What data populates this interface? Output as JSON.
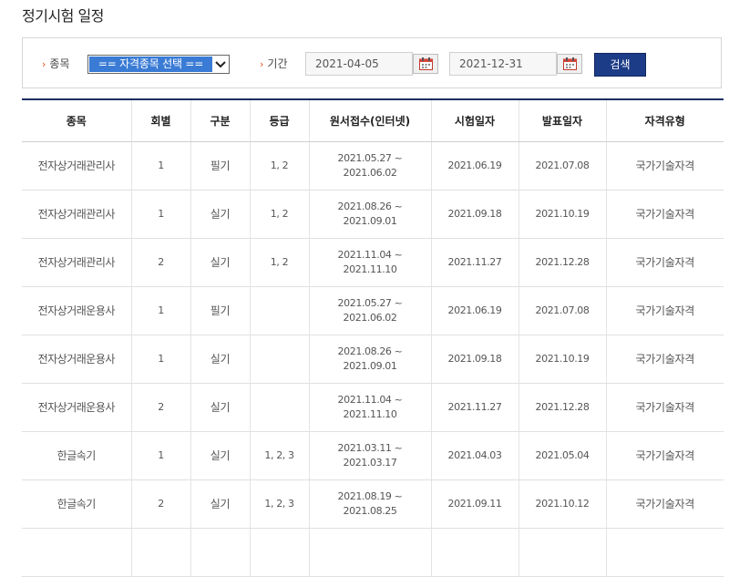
{
  "page": {
    "title": "정기시험 일정"
  },
  "search": {
    "type_label": "종목",
    "type_selected": "== 자격종목 선택 ==",
    "period_label": "기간",
    "start_date": "2021-04-05",
    "end_date": "2021-12-31",
    "button_label": "검색"
  },
  "table": {
    "headers": [
      "종목",
      "회별",
      "구분",
      "등급",
      "원서접수(인터넷)",
      "시험일자",
      "발표일자",
      "자격유형"
    ],
    "rows": [
      [
        "전자상거래관리사",
        "1",
        "필기",
        "1, 2",
        "2021.05.27 ~",
        "2021.06.02",
        "2021.06.19",
        "2021.07.08",
        "국가기술자격"
      ],
      [
        "전자상거래관리사",
        "1",
        "실기",
        "1, 2",
        "2021.08.26 ~",
        "2021.09.01",
        "2021.09.18",
        "2021.10.19",
        "국가기술자격"
      ],
      [
        "전자상거래관리사",
        "2",
        "실기",
        "1, 2",
        "2021.11.04 ~",
        "2021.11.10",
        "2021.11.27",
        "2021.12.28",
        "국가기술자격"
      ],
      [
        "전자상거래운용사",
        "1",
        "필기",
        "",
        "2021.05.27 ~",
        "2021.06.02",
        "2021.06.19",
        "2021.07.08",
        "국가기술자격"
      ],
      [
        "전자상거래운용사",
        "1",
        "실기",
        "",
        "2021.08.26 ~",
        "2021.09.01",
        "2021.09.18",
        "2021.10.19",
        "국가기술자격"
      ],
      [
        "전자상거래운용사",
        "2",
        "실기",
        "",
        "2021.11.04 ~",
        "2021.11.10",
        "2021.11.27",
        "2021.12.28",
        "국가기술자격"
      ],
      [
        "한글속기",
        "1",
        "실기",
        "1, 2, 3",
        "2021.03.11 ~",
        "2021.03.17",
        "2021.04.03",
        "2021.05.04",
        "국가기술자격"
      ],
      [
        "한글속기",
        "2",
        "실기",
        "1, 2, 3",
        "2021.08.19 ~",
        "2021.08.25",
        "2021.09.11",
        "2021.10.12",
        "국가기술자격"
      ],
      [
        "",
        "",
        "",
        "",
        "",
        "",
        "",
        "",
        ""
      ]
    ]
  },
  "colors": {
    "accent_navy": "#1d3c87",
    "arrow_orange": "#e0531d",
    "select_highlight": "#3a7bd5"
  }
}
